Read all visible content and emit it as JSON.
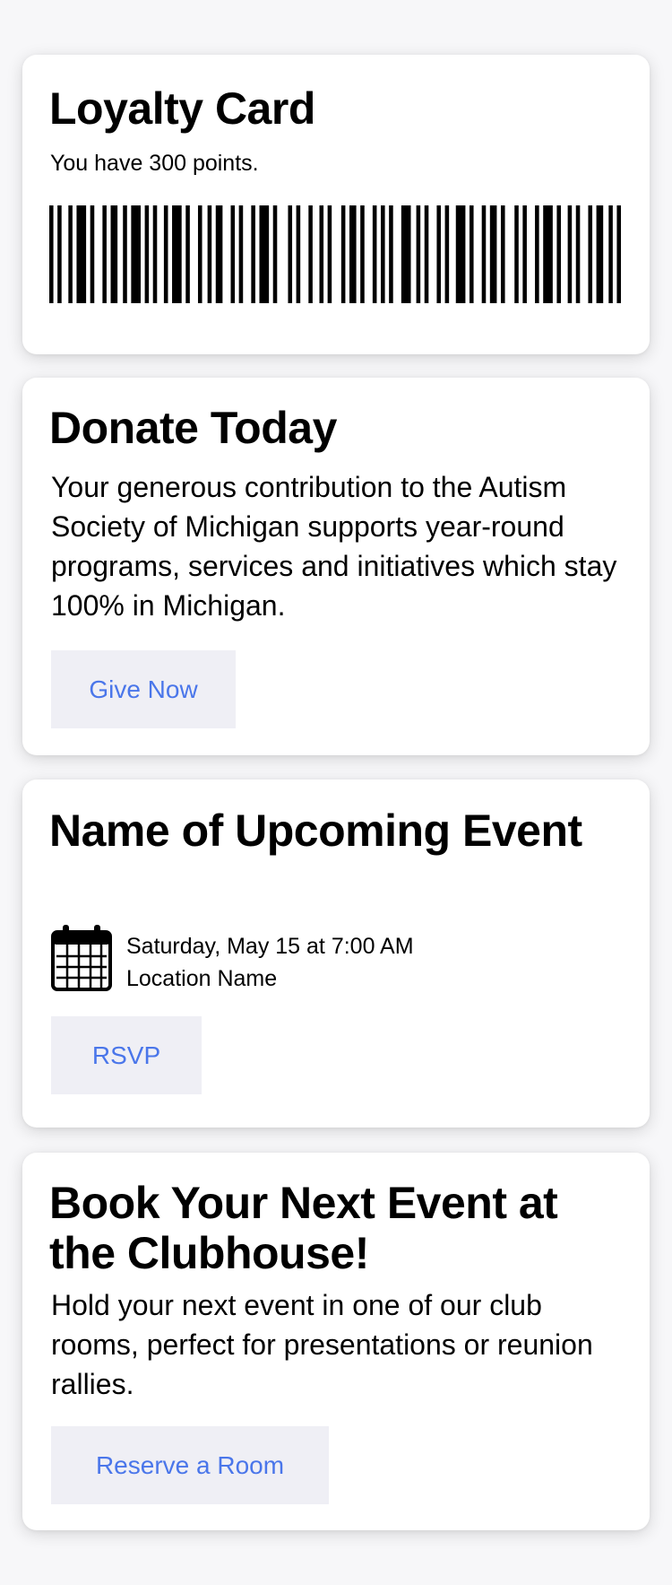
{
  "loyalty": {
    "title": "Loyalty Card",
    "points_text": "You have 300 points."
  },
  "donate": {
    "title": "Donate Today",
    "body": "Your generous contribution to the Autism Society of Michigan supports year-round programs, services and initiatives which stay 100% in Michigan.",
    "button": "Give Now"
  },
  "event": {
    "title": "Name of Upcoming Event",
    "datetime": "Saturday, May 15 at 7:00 AM",
    "location": "Location Name",
    "icon": "calendar-icon",
    "button": "RSVP"
  },
  "clubhouse": {
    "title": "Book Your Next Event at the Clubhouse!",
    "body": "Hold your next event in one of our club rooms, perfect for presentations or reunion rallies.",
    "button": "Reserve a Room"
  },
  "colors": {
    "accent": "#4a76ea",
    "button_bg": "#efeff5",
    "card_bg": "#ffffff",
    "page_bg": "#f7f7f9"
  }
}
